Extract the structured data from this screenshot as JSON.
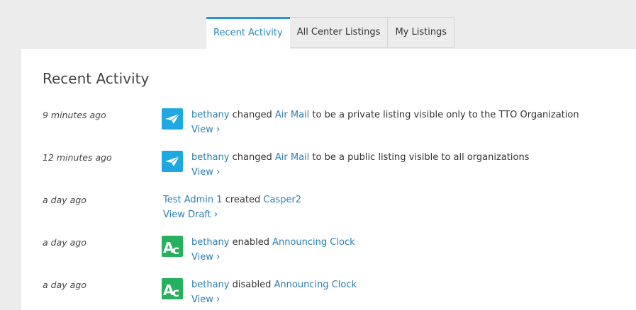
{
  "tabs": [
    "Recent Activity",
    "All Center Listings",
    "My Listings"
  ],
  "heading": "Recent Activity",
  "activities": [
    {
      "time": "9 minutes ago",
      "icon": "paper-plane-icon",
      "user": "bethany",
      "verb": "changed",
      "target": "Air Mail",
      "rest": "to be a private listing visible only to the TTO Organization",
      "link": "View"
    },
    {
      "time": "12 minutes ago",
      "icon": "paper-plane-icon",
      "user": "bethany",
      "verb": "changed",
      "target": "Air Mail",
      "rest": "to be a public listing visible to all organizations",
      "link": "View"
    },
    {
      "time": "a day ago",
      "icon": "",
      "user": "Test Admin 1",
      "verb": "created",
      "target": "Casper2",
      "rest": "",
      "link": "View Draft"
    },
    {
      "time": "a day ago",
      "icon": "ac-logo-icon",
      "user": "bethany",
      "verb": "enabled",
      "target": "Announcing Clock",
      "rest": "",
      "link": "View"
    },
    {
      "time": "a day ago",
      "icon": "ac-logo-icon",
      "user": "bethany",
      "verb": "disabled",
      "target": "Announcing Clock",
      "rest": "",
      "link": "View"
    }
  ],
  "chevron": "›"
}
